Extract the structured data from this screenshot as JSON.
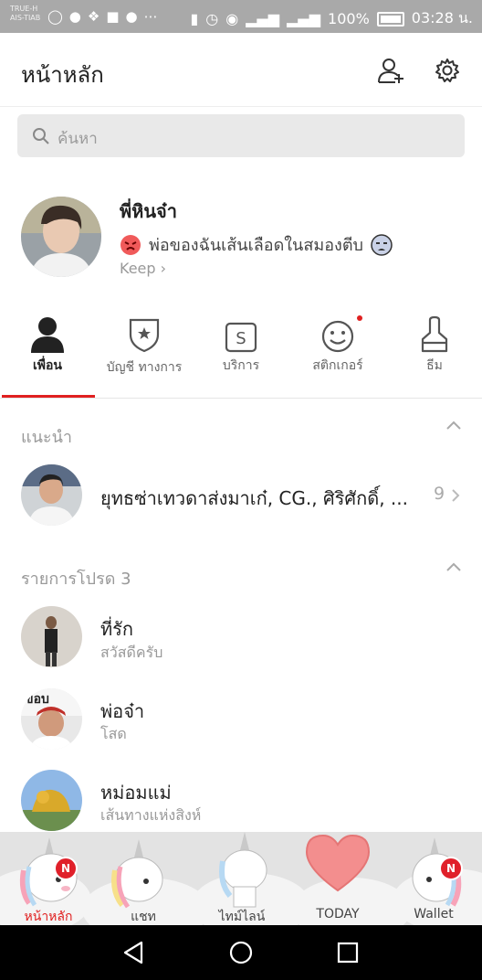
{
  "status_bar": {
    "carrier_top": "TRUE-H",
    "carrier_bottom": "AIS-TIAB",
    "battery": "100%",
    "time": "03:28 น."
  },
  "header": {
    "title": "หน้าหลัก",
    "add_friend_icon": "add-friend-icon",
    "settings_icon": "gear-icon"
  },
  "search": {
    "placeholder": "ค้นหา"
  },
  "profile": {
    "name": "พี่หินจ๋า",
    "status": "พ่อของฉันเส้นเลือดในสมองตีบ",
    "keep": "Keep"
  },
  "tabs": [
    {
      "label": "เพื่อน",
      "icon": "person-icon"
    },
    {
      "label": "บัญชี ทางการ",
      "icon": "official-account-icon"
    },
    {
      "label": "บริการ",
      "icon": "service-icon"
    },
    {
      "label": "สติกเกอร์",
      "icon": "sticker-icon"
    },
    {
      "label": "ธีม",
      "icon": "theme-brush-icon"
    }
  ],
  "recommend": {
    "title": "แนะนำ",
    "text": "ยุทธซ่าเทวดาส่งมาเก๋, CG., ศิริศักดิ์, ...",
    "count": "9"
  },
  "favorites": {
    "title": "รายการโปรด 3",
    "items": [
      {
        "name": "ที่รัก",
        "sub": "สวัสดีครับ"
      },
      {
        "name": "พ่อจ๋า",
        "sub": "โสด"
      },
      {
        "name": "หม่อมแม่",
        "sub": "เส้นทางแห่งสิงห์"
      }
    ]
  },
  "bottom_tabs": [
    {
      "label": "หน้าหลัก",
      "badge": "N"
    },
    {
      "label": "แชท"
    },
    {
      "label": "ไทม์ไลน์"
    },
    {
      "label": "TODAY"
    },
    {
      "label": "Wallet",
      "badge": "N"
    }
  ],
  "colors": {
    "accent": "#e02020",
    "statusbar": "#a9a9a9"
  }
}
